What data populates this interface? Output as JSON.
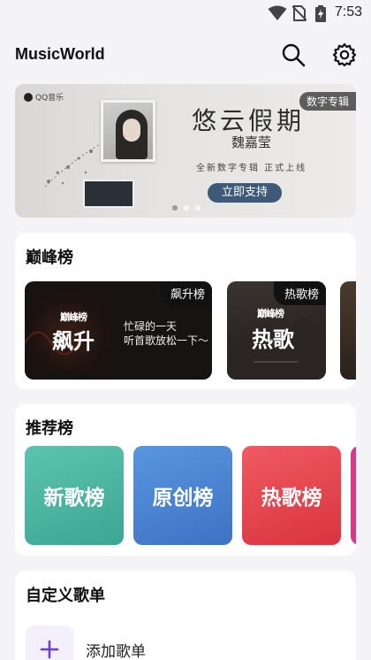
{
  "status_bar": {
    "time": "7:53",
    "icons": [
      "wifi-icon",
      "no-sim-icon",
      "battery-charging-icon"
    ]
  },
  "header": {
    "title": "MusicWorld",
    "icons": [
      "search-icon",
      "gear-icon"
    ]
  },
  "banner": {
    "tag": "数字专辑",
    "logo_text": "QQ音乐",
    "album_title": "悠云假期",
    "artist": "魏嘉莹",
    "subtitle": "全新数字专辑 正式上线",
    "button": "立即支持",
    "page_count": 3,
    "active_page": 1
  },
  "peak_section": {
    "title": "巅峰榜",
    "cards": [
      {
        "tag": "飙升榜",
        "logo": "巅峰榜",
        "big_text": "飙升",
        "desc_line1": "忙碌的一天",
        "desc_line2": "听首歌放松一下～"
      },
      {
        "tag": "热歌榜",
        "logo": "巅峰榜",
        "big_text": "热歌"
      }
    ]
  },
  "recommend_section": {
    "title": "推荐榜",
    "cards": [
      {
        "label": "新歌榜",
        "color": "#4cb9a4"
      },
      {
        "label": "原创榜",
        "color": "#4a87d4"
      },
      {
        "label": "热歌榜",
        "color": "#e6454f"
      }
    ]
  },
  "custom_section": {
    "title": "自定义歌单",
    "add_label": "添加歌单",
    "add_icon": "plus-icon",
    "accent": "#6c3fd8"
  }
}
